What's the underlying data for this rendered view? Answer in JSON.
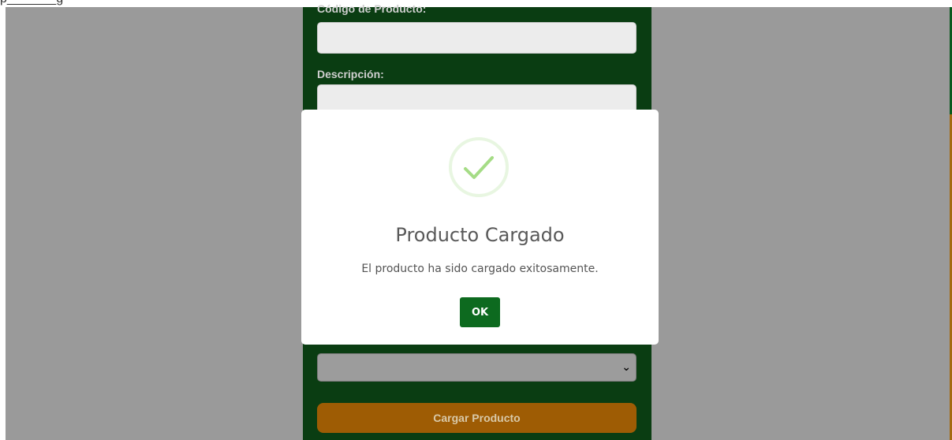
{
  "top_stub": "p_______g",
  "form": {
    "code_label": "Código de Producto:",
    "description_label": "Descripción:",
    "select_arrow": "⌄",
    "submit_label": "Cargar Producto"
  },
  "modal": {
    "icon": "check-icon",
    "title": "Producto Cargado",
    "message": "El producto ha sido cargado exitosamente.",
    "ok_label": "OK"
  },
  "colors": {
    "backdrop": "#9a9a9a",
    "form_panel": "#0a3d12",
    "submit_button": "#9e5c04",
    "ok_button": "#0d6a1f",
    "check": "#a5dc86"
  }
}
